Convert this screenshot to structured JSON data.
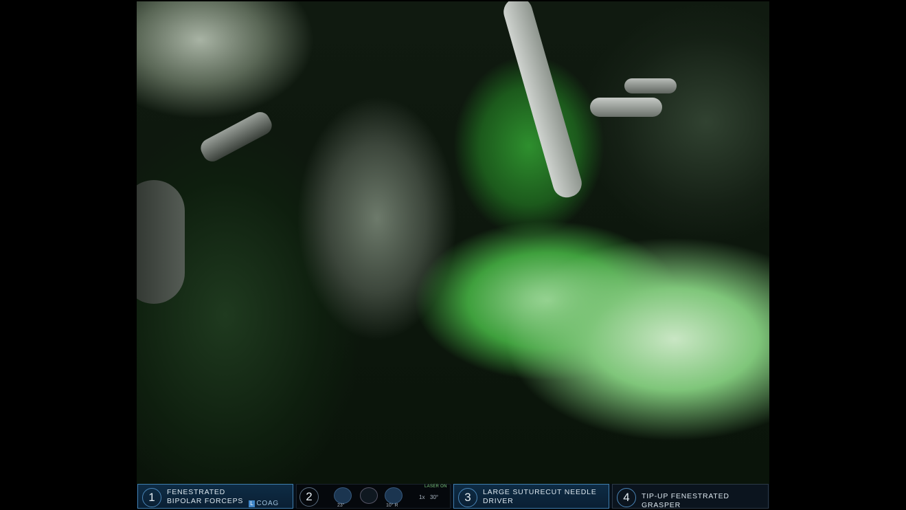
{
  "arms": [
    {
      "number": "1",
      "line1": "FENESTRATED",
      "line2": "BIPOLAR FORCEPS",
      "energy_letter": "L",
      "energy_mode": "COAG",
      "state": "active"
    },
    {
      "number": "2",
      "state": "camera"
    },
    {
      "number": "3",
      "line1": "LARGE SUTURECUT NEEDLE",
      "line2": "DRIVER",
      "state": "active"
    },
    {
      "number": "4",
      "line1": "TIP-UP FENESTRATED GRASPER",
      "line2": "",
      "state": "inactive"
    }
  ],
  "camera": {
    "angle_left": "23°",
    "angle_right": "10° R",
    "zoom": "1x",
    "scope_angle": "30°",
    "laser_status": "LASER ON"
  },
  "colors": {
    "arm_active_border": "#3f7fb0",
    "arm_active_bg": "#0e2c45",
    "arm_inactive_bg": "#0b141e",
    "fluorescence_green": "#4fbf4f",
    "coag_badge": "#3f86c8"
  }
}
